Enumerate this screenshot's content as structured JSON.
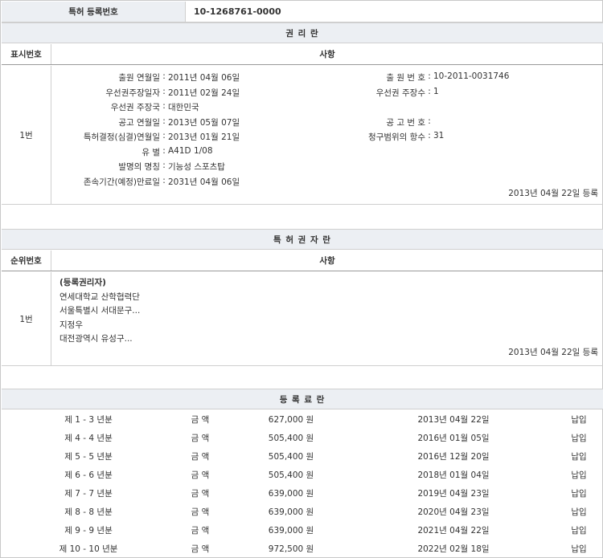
{
  "registration": {
    "label": "특허 등록번호",
    "number": "10-1268761-0000"
  },
  "rights_section": {
    "title": "권 리 란",
    "col_index": "표시번호",
    "col_content": "사항",
    "index": "1번",
    "left_fields": [
      {
        "label": "출원 연월일",
        "value": "2011년 04월 06일"
      },
      {
        "label": "우선권주장일자",
        "value": "2011년 02월 24일"
      },
      {
        "label": "우선권 주장국",
        "value": "대한민국"
      },
      {
        "label": "공고 연월일",
        "value": "2013년 05월 07일"
      },
      {
        "label": "특허결정(심결)연월일",
        "value": "2013년 01월 21일"
      },
      {
        "label": "유 별",
        "value": "A41D 1/08"
      },
      {
        "label": "발명의 명칭",
        "value": "기능성 스포츠탑"
      },
      {
        "label": "존속기간(예정)만료일",
        "value": "2031년 04월 06일"
      }
    ],
    "right_fields": [
      {
        "label": "출 원 번 호",
        "value": "10-2011-0031746"
      },
      {
        "label": "우선권 주장수",
        "value": "1"
      },
      {
        "label": "",
        "value": ""
      },
      {
        "label": "공 고 번 호",
        "value": ""
      },
      {
        "label": "청구범위의 항수",
        "value": "31"
      }
    ],
    "reg_date": "2013년 04월 22일 등록"
  },
  "holder_section": {
    "title": "특 허 권 자 란",
    "col_index": "순위번호",
    "col_content": "사항",
    "index": "1번",
    "lines": [
      "(등록권리자)",
      "연세대학교 산학협력단",
      "서울특별시 서대문구...",
      "지정우",
      "대전광역시 유성구..."
    ],
    "reg_date": "2013년 04월 22일 등록"
  },
  "fee_section": {
    "title": "등 록 료 란",
    "rows": [
      {
        "period": "제 1 - 3 년분",
        "label": "금 액",
        "amount": "627,000 원",
        "date": "2013년 04월 22일",
        "status": "납입"
      },
      {
        "period": "제 4 - 4 년분",
        "label": "금 액",
        "amount": "505,400 원",
        "date": "2016년 01월 05일",
        "status": "납입"
      },
      {
        "period": "제 5 - 5 년분",
        "label": "금 액",
        "amount": "505,400 원",
        "date": "2016년 12월 20일",
        "status": "납입"
      },
      {
        "period": "제 6 - 6 년분",
        "label": "금 액",
        "amount": "505,400 원",
        "date": "2018년 01월 04일",
        "status": "납입"
      },
      {
        "period": "제 7 - 7 년분",
        "label": "금 액",
        "amount": "639,000 원",
        "date": "2019년 04월 23일",
        "status": "납입"
      },
      {
        "period": "제 8 - 8 년분",
        "label": "금 액",
        "amount": "639,000 원",
        "date": "2020년 04월 23일",
        "status": "납입"
      },
      {
        "period": "제 9 - 9 년분",
        "label": "금 액",
        "amount": "639,000 원",
        "date": "2021년 04월 22일",
        "status": "납입"
      },
      {
        "period": "제 10 - 10 년분",
        "label": "금 액",
        "amount": "972,500 원",
        "date": "2022년 02월 18일",
        "status": "납입"
      }
    ]
  }
}
